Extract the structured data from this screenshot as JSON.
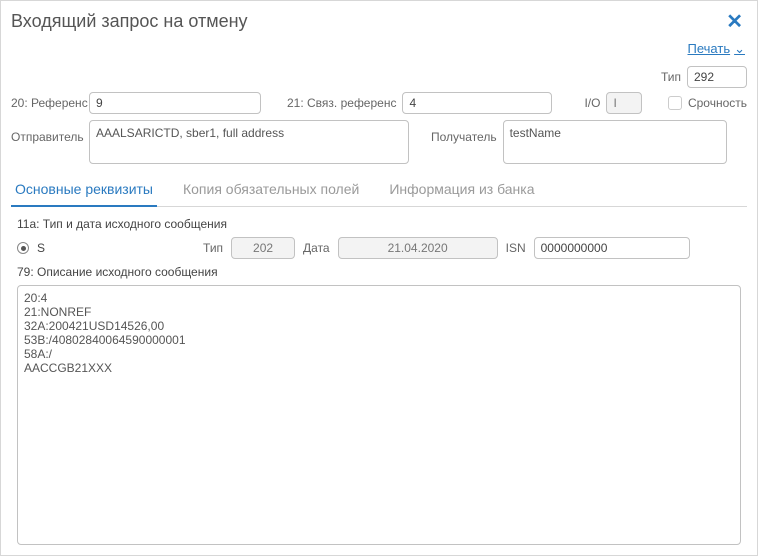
{
  "window": {
    "title": "Входящий запрос на отмену"
  },
  "actions": {
    "print": "Печать"
  },
  "top": {
    "type_label": "Тип",
    "type_value": "292",
    "ref20_label": "20: Референс",
    "ref20_value": "9",
    "ref21_label": "21: Связ. референс",
    "ref21_value": "4",
    "io_label": "I/O",
    "io_value": "I",
    "urgent_label": "Срочность",
    "sender_label": "Отправитель",
    "sender_value": "AAALSARICTD, sber1, full address",
    "receiver_label": "Получатель",
    "receiver_value": "testName"
  },
  "tabs": {
    "t1": "Основные реквизиты",
    "t2": "Копия обязательных полей",
    "t3": "Информация из банка"
  },
  "main": {
    "section11a": "11a: Тип и дата исходного сообщения",
    "radio_s": "S",
    "type_label": "Тип",
    "type_value": "202",
    "date_label": "Дата",
    "date_value": "21.04.2020",
    "isn_label": "ISN",
    "isn_value": "0000000000",
    "section79": "79: Описание исходного сообщения",
    "body79": "20:4\n21:NONREF\n32A:200421USD14526,00\n53B:/40802840064590000001\n58A:/\nAACCGB21XXX"
  }
}
